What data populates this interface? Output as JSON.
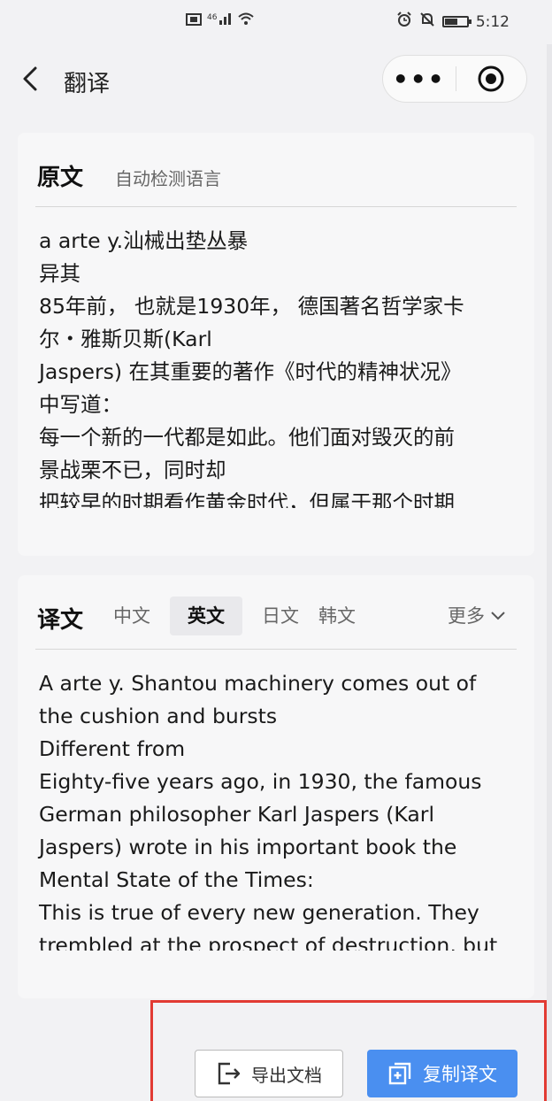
{
  "status_bar": {
    "time": "5:12",
    "icons_center": [
      "sim-icon",
      "signal-icon",
      "wifi-icon"
    ],
    "icons_right": [
      "alarm-icon",
      "mute-icon",
      "battery-icon"
    ]
  },
  "nav": {
    "title": "翻译",
    "back_icon": "chevron-left-icon",
    "more_label": "•••",
    "target_icon": "target-icon"
  },
  "source_card": {
    "title": "原文",
    "subtitle": "自动检测语言",
    "lines": [
      "a arte y.汕械出垫丛暴",
      "异其",
      "85年前， 也就是1930年， 德国著名哲学家卡",
      "尔・雅斯贝斯(Karl",
      "Jaspers) 在其重要的著作《时代的精神状况》",
      "中写道：",
      "每一个新的一代都是如此。他们面对毁灭的前",
      "景战栗不已，同时却",
      "把较早的时期看作黄金时代，但属于那个时期"
    ]
  },
  "target_card": {
    "title": "译文",
    "tabs": [
      "中文",
      "英文",
      "日文",
      "韩文"
    ],
    "active_tab": "英文",
    "more_label": "更多",
    "lines": [
      "A arte y. Shantou machinery comes out of",
      "the cushion and bursts",
      "Different from",
      "Eighty-five years ago, in 1930, the famous",
      "German philosopher Karl Jaspers (Karl",
      "Jaspers) wrote in his important book the",
      "Mental State of the Times:",
      "This is true of every new generation. They",
      "trembled at the prospect of destruction, but"
    ]
  },
  "actions": {
    "export_label": "导出文档",
    "copy_label": "复制译文",
    "copy_color": "#4a8ff0",
    "highlight_color": "#e23b33"
  }
}
